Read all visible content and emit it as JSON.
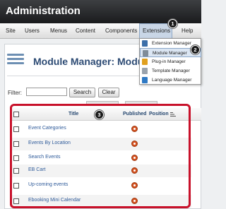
{
  "header": {
    "title": "Administration"
  },
  "menubar": {
    "items": [
      {
        "key": "site",
        "label": "Site"
      },
      {
        "key": "users",
        "label": "Users"
      },
      {
        "key": "menus",
        "label": "Menus"
      },
      {
        "key": "content",
        "label": "Content"
      },
      {
        "key": "components",
        "label": "Components"
      },
      {
        "key": "extensions",
        "label": "Extensions"
      },
      {
        "key": "help",
        "label": "Help"
      }
    ],
    "active": "Extensions"
  },
  "dropdown": {
    "items": [
      {
        "label": "Extension Manager",
        "icon": "extension-manager-icon",
        "color": "#3b6ea8"
      },
      {
        "label": "Module Manager",
        "icon": "module-manager-icon",
        "color": "#7f8c99"
      },
      {
        "label": "Plug-in Manager",
        "icon": "plugin-manager-icon",
        "color": "#e0a020"
      },
      {
        "label": "Template Manager",
        "icon": "template-manager-icon",
        "color": "#9aa3ad"
      },
      {
        "label": "Language Manager",
        "icon": "language-manager-icon",
        "color": "#2f79c4"
      }
    ],
    "highlighted": "Module Manager"
  },
  "callouts": {
    "one": "1",
    "two": "2",
    "three": "3"
  },
  "page": {
    "title": "Module Manager: Modules"
  },
  "filter": {
    "label": "Filter:",
    "value": "",
    "search_label": "Search",
    "clear_label": "Clear"
  },
  "table": {
    "headers": {
      "title": "Title",
      "published": "Published",
      "position": "Position"
    },
    "rows": [
      {
        "title": "Event Categories",
        "published": true
      },
      {
        "title": "Events By Location",
        "published": true
      },
      {
        "title": "Search Events",
        "published": true
      },
      {
        "title": "EB Cart",
        "published": true
      },
      {
        "title": "Up-coming events",
        "published": true
      },
      {
        "title": "Ebooking Mini Calendar",
        "published": true
      }
    ]
  },
  "colors": {
    "highlight": "#c8112a",
    "title_blue": "#2d4b74",
    "link_blue": "#2f5b9a",
    "published_icon": "#d4501e"
  }
}
